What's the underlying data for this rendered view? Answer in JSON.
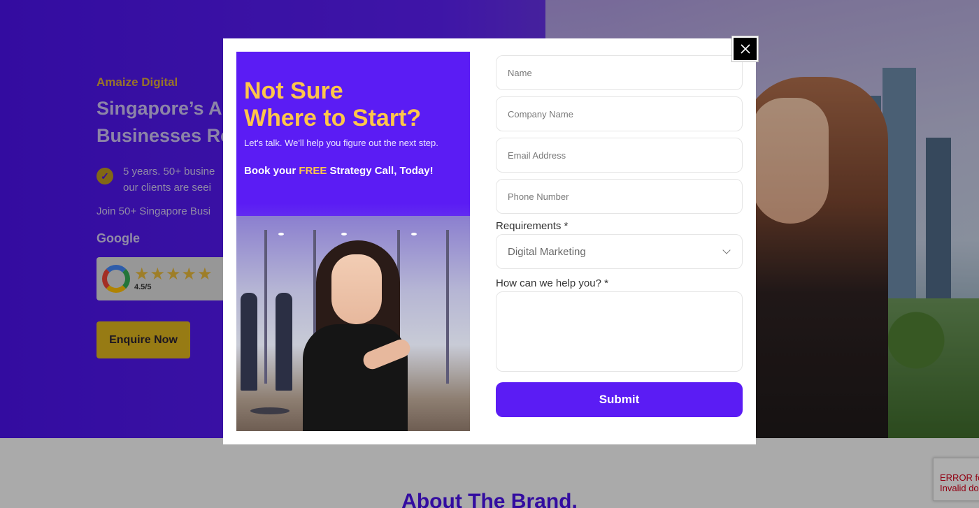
{
  "hero": {
    "brand": "Amaize Digital",
    "title_line1": "Singapore’s A",
    "title_line2": "Businesses Re",
    "point_line1": "5 years. 50+ busine",
    "point_line2": "our clients are seei",
    "join_text": "Join 50+ Singapore Busi",
    "google_label": "Google",
    "rating_stars": "★★★★★",
    "rating_value": "4.5/5",
    "enquire_label": "Enquire Now"
  },
  "about": {
    "title": "About The Brand."
  },
  "captcha": {
    "line1": "ERROR fo",
    "line2": "Invalid do"
  },
  "modal": {
    "promo": {
      "title_line1": "Not Sure",
      "title_line2": "Where to Start?",
      "subtitle": "Let's talk. We'll help you figure out the next step.",
      "cta_prefix": "Book your ",
      "cta_free": "FREE",
      "cta_suffix": " Strategy Call, Today!"
    },
    "form": {
      "name_placeholder": "Name",
      "company_placeholder": "Company Name",
      "email_placeholder": "Email Address",
      "phone_placeholder": "Phone Number",
      "requirements_label": "Requirements *",
      "requirements_value": "Digital Marketing",
      "help_label": "How can we help you? *",
      "help_value": "",
      "submit_label": "Submit"
    }
  },
  "colors": {
    "brand_purple": "#5b1cf4",
    "accent_yellow": "#ffc64a",
    "button_gold": "#d8b11e"
  }
}
